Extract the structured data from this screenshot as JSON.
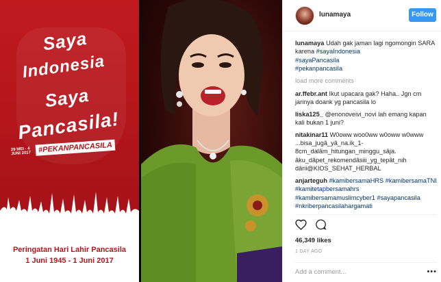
{
  "post": {
    "username": "lunamaya",
    "follow_label": "Follow",
    "likes": "46,349 likes",
    "timestamp": "1 DAY AGO",
    "add_comment_placeholder": "Add a comment...",
    "more_icon": "ellipsis-icon",
    "like_icon": "heart-icon",
    "comment_icon": "speech-bubble-icon"
  },
  "poster": {
    "line1": "Saya",
    "line2": "Indonesia",
    "line3": "Saya",
    "line4": "Pancasila!",
    "tag_date": "29 MEI - 4 JUNI 2017",
    "hashtag": "#PEKANPANCASILA",
    "footer_line1": "Peringatan Hari Lahir Pancasila",
    "footer_line2": "1 Juni 1945 - 1 Juni 2017"
  },
  "caption": {
    "user": "lunamaya",
    "text": "Udah gak jaman lagi ngomongin SARA karena",
    "tags": [
      "#sayaIndonesia",
      "#sayaPancasila",
      "#pekanpancasila"
    ]
  },
  "load_more": "load more comments",
  "comments": [
    {
      "user": "ar.ffebr.ant",
      "text": "Ikut upacara gak? Haha.. Jgn cm jarinya doank yg pancasila lo"
    },
    {
      "user": "liska125_",
      "text": "@enonoveivi_novi lah emang kapan kali bukan 1 juni?"
    },
    {
      "user": "nitakinar11",
      "text": "W0oww woo0ww w0oww w0www ...bisa_jugâ_yâ_na.ik_1-8cm_dalâm_hitungan_minggu_sâja. âku_dâpet_rekomendâsiii_yg_tepât_nih dârii@KIOS_SEHAT_HERBAL"
    },
    {
      "user": "anjarteguh",
      "text": "#kamibersamaHRS #kamibersamaTNI #kamitetapbersamahrs #kamibersamamuslimcyber1 #sayapancasila #nkriberpancasilahargamati"
    }
  ]
}
